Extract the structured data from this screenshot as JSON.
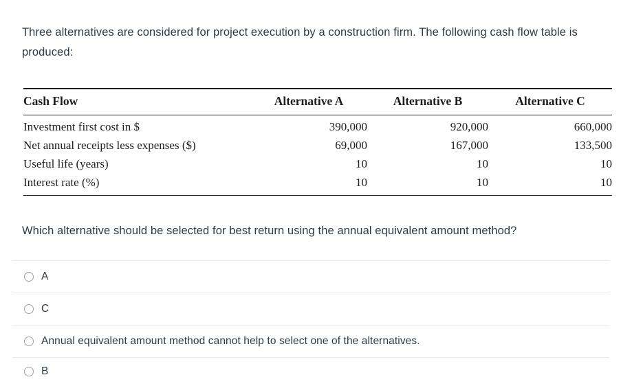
{
  "question": {
    "stem": "Three alternatives are considered for project execution by a construction firm. The following cash flow table is produced:",
    "subquestion": "Which alternative should be selected for best return using the annual equivalent amount method?"
  },
  "table": {
    "headers": {
      "label": "Cash Flow",
      "alt_a": "Alternative A",
      "alt_b": "Alternative B",
      "alt_c": "Alternative C"
    },
    "rows": [
      {
        "label": "Investment first cost in $",
        "alt_a": "390,000",
        "alt_b": "920,000",
        "alt_c": "660,000"
      },
      {
        "label": "Net annual receipts less expenses ($)",
        "alt_a": "69,000",
        "alt_b": "167,000",
        "alt_c": "133,500"
      },
      {
        "label": "Useful life (years)",
        "alt_a": "10",
        "alt_b": "10",
        "alt_c": "10"
      },
      {
        "label": "Interest rate (%)",
        "alt_a": "10",
        "alt_b": "10",
        "alt_c": "10"
      }
    ]
  },
  "options": [
    {
      "label": "A",
      "icon": "radio-unselected-icon",
      "selected": false
    },
    {
      "label": "C",
      "icon": "radio-unselected-icon",
      "selected": false
    },
    {
      "label": "Annual equivalent amount method cannot help to select one of the alternatives.",
      "icon": "radio-unselected-icon",
      "selected": false
    },
    {
      "label": "B",
      "icon": "radio-unselected-icon",
      "selected": false
    }
  ],
  "colors": {
    "text": "#2d3b45",
    "table_text": "#1d1d1d",
    "divider": "#e8eaec",
    "radio_border": "#9ba3a9",
    "background": "#ffffff"
  }
}
